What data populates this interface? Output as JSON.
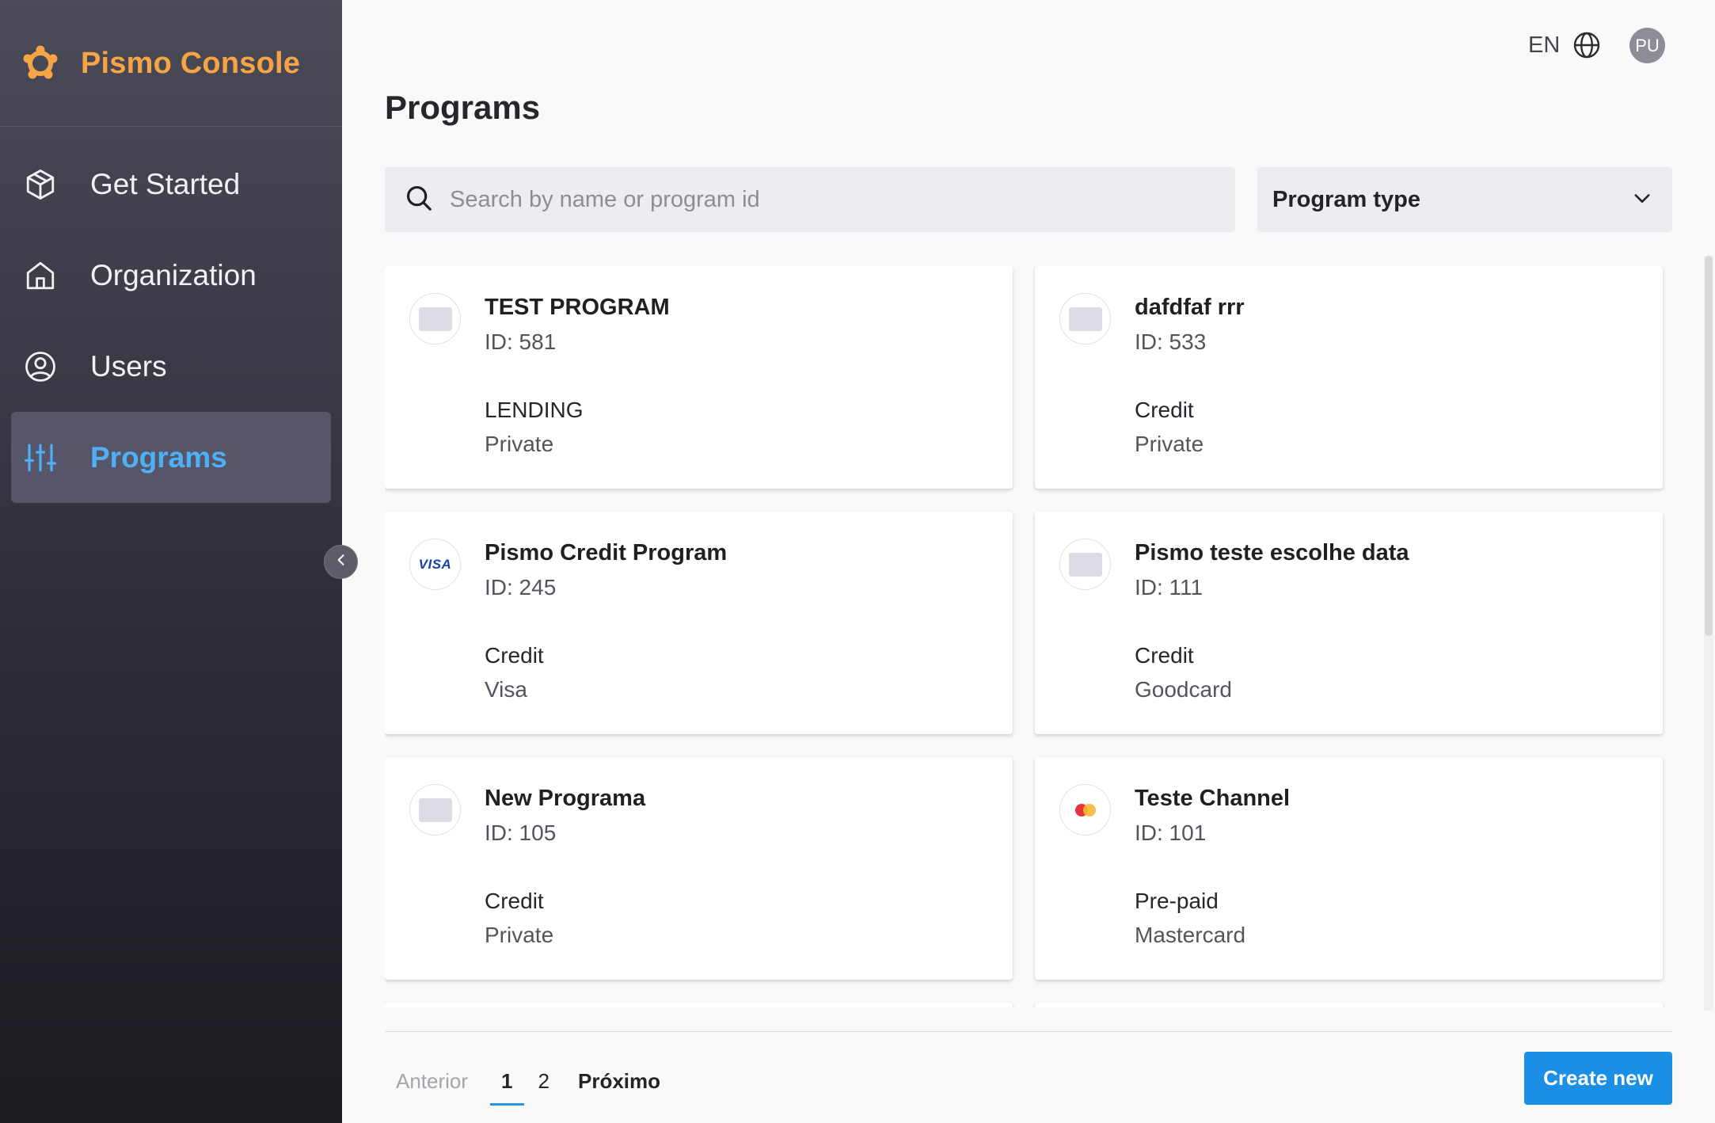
{
  "brand": {
    "name": "Pismo Console",
    "color": "#f5a546"
  },
  "sidebar": {
    "items": [
      {
        "label": "Get Started",
        "icon": "cube-icon",
        "active": false
      },
      {
        "label": "Organization",
        "icon": "home-icon",
        "active": false
      },
      {
        "label": "Users",
        "icon": "user-circle-icon",
        "active": false
      },
      {
        "label": "Programs",
        "icon": "sliders-icon",
        "active": true
      }
    ],
    "active_color": "#4fb1f3"
  },
  "topbar": {
    "language": "EN",
    "avatar_initials": "PU"
  },
  "page": {
    "title": "Programs"
  },
  "search": {
    "placeholder": "Search by name or program id",
    "value": ""
  },
  "filter": {
    "label": "Program type"
  },
  "programs": [
    {
      "name": "TEST PROGRAM",
      "id": "ID: 581",
      "type": "LENDING",
      "brand": "Private",
      "icon": "card-placeholder-icon"
    },
    {
      "name": "dafdfaf rrr",
      "id": "ID: 533",
      "type": "Credit",
      "brand": "Private",
      "icon": "card-placeholder-icon"
    },
    {
      "name": "Pismo Credit Program",
      "id": "ID: 245",
      "type": "Credit",
      "brand": "Visa",
      "icon": "visa-logo-icon",
      "icon_text": "VISA"
    },
    {
      "name": "Pismo teste escolhe data",
      "id": "ID: 111",
      "type": "Credit",
      "brand": "Goodcard",
      "icon": "card-placeholder-icon"
    },
    {
      "name": "New Programa",
      "id": "ID: 105",
      "type": "Credit",
      "brand": "Private",
      "icon": "card-placeholder-icon"
    },
    {
      "name": "Teste Channel",
      "id": "ID: 101",
      "type": "Pre-paid",
      "brand": "Mastercard",
      "icon": "mastercard-logo-icon"
    }
  ],
  "pagination": {
    "prev": "Anterior",
    "pages": [
      "1",
      "2"
    ],
    "current": "1",
    "next": "Próximo"
  },
  "actions": {
    "create_label": "Create new",
    "primary_color": "#1b8fe6"
  }
}
